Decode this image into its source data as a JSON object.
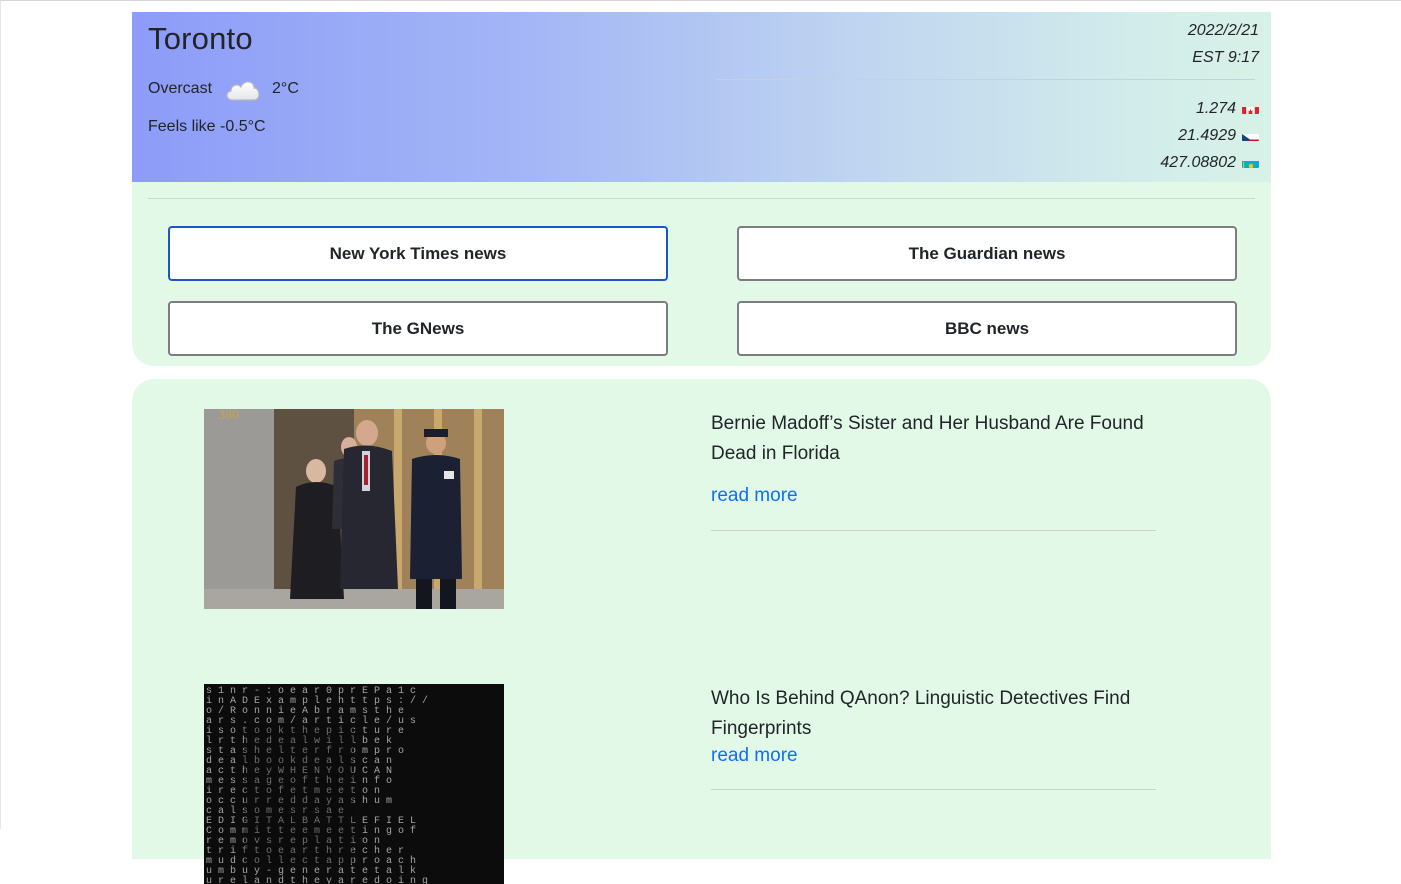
{
  "weather": {
    "city": "Toronto",
    "condition": "Overcast",
    "condition_icon": "cloud-icon",
    "temperature": "2°C",
    "feels_like": "Feels like -0.5°C",
    "date": "2022/2/21",
    "time": "EST 9:17"
  },
  "rates": [
    {
      "value": "1.274",
      "flag": "canada-flag-icon"
    },
    {
      "value": "21.4929",
      "flag": "czech-flag-icon"
    },
    {
      "value": "427.08802",
      "flag": "kazakhstan-flag-icon"
    }
  ],
  "sources": {
    "nyt": "New York Times news",
    "guardian": "The Guardian news",
    "gnews": "The GNews",
    "bbc": "BBC news",
    "active": "nyt"
  },
  "news": [
    {
      "title": "Bernie Madoff’s Sister and Her Husband Are Found Dead in Florida",
      "link": "read more"
    },
    {
      "title": "Who Is Behind QAnon? Linguistic Detectives Find Fingerprints",
      "link": "read more"
    }
  ],
  "colors": {
    "accent": "#0d6efd",
    "card_bg": "#e3f9e8",
    "active_border": "#1a56c8"
  }
}
